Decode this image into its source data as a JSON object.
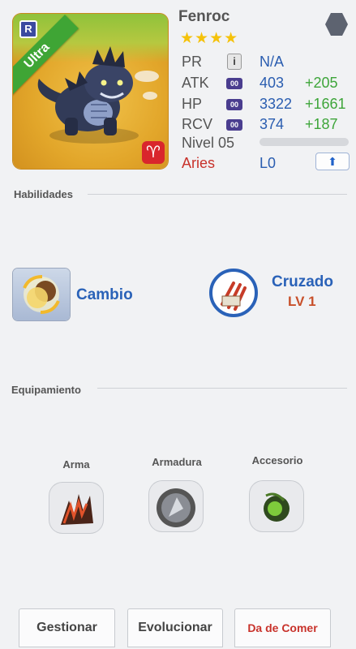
{
  "monster": {
    "name": "Fenroc",
    "stars": "★★★★",
    "rarity": "Ultra",
    "rank_letter": "R",
    "zodiac_symbol": "♈"
  },
  "stats": [
    {
      "label": "PR",
      "value": "N/A",
      "bonus": "",
      "pill": ""
    },
    {
      "label": "ATK",
      "value": "403",
      "bonus": "+205",
      "pill": "00"
    },
    {
      "label": "HP",
      "value": "3322",
      "bonus": "+1661",
      "pill": "00"
    },
    {
      "label": "RCV",
      "value": "374",
      "bonus": "+187",
      "pill": "00"
    }
  ],
  "level": {
    "label": "Nivel 05"
  },
  "element": {
    "name": "Aries",
    "rank": "L0"
  },
  "skills": {
    "title": "Habilidades",
    "active": {
      "name": "Cambio"
    },
    "leader": {
      "name": "Cruzado",
      "level": "LV 1"
    }
  },
  "equipment": {
    "title": "Equipamiento",
    "slots": [
      {
        "label": "Arma"
      },
      {
        "label": "Armadura"
      },
      {
        "label": "Accesorio"
      }
    ]
  },
  "actions": {
    "manage": "Gestionar",
    "evolve": "Evolucionar",
    "feed": "Da de Comer"
  },
  "colors": {
    "accent_blue": "#2a5db0",
    "bonus_green": "#3ea53a",
    "aries_red": "#c8322b",
    "star_yellow": "#f5c20a"
  }
}
